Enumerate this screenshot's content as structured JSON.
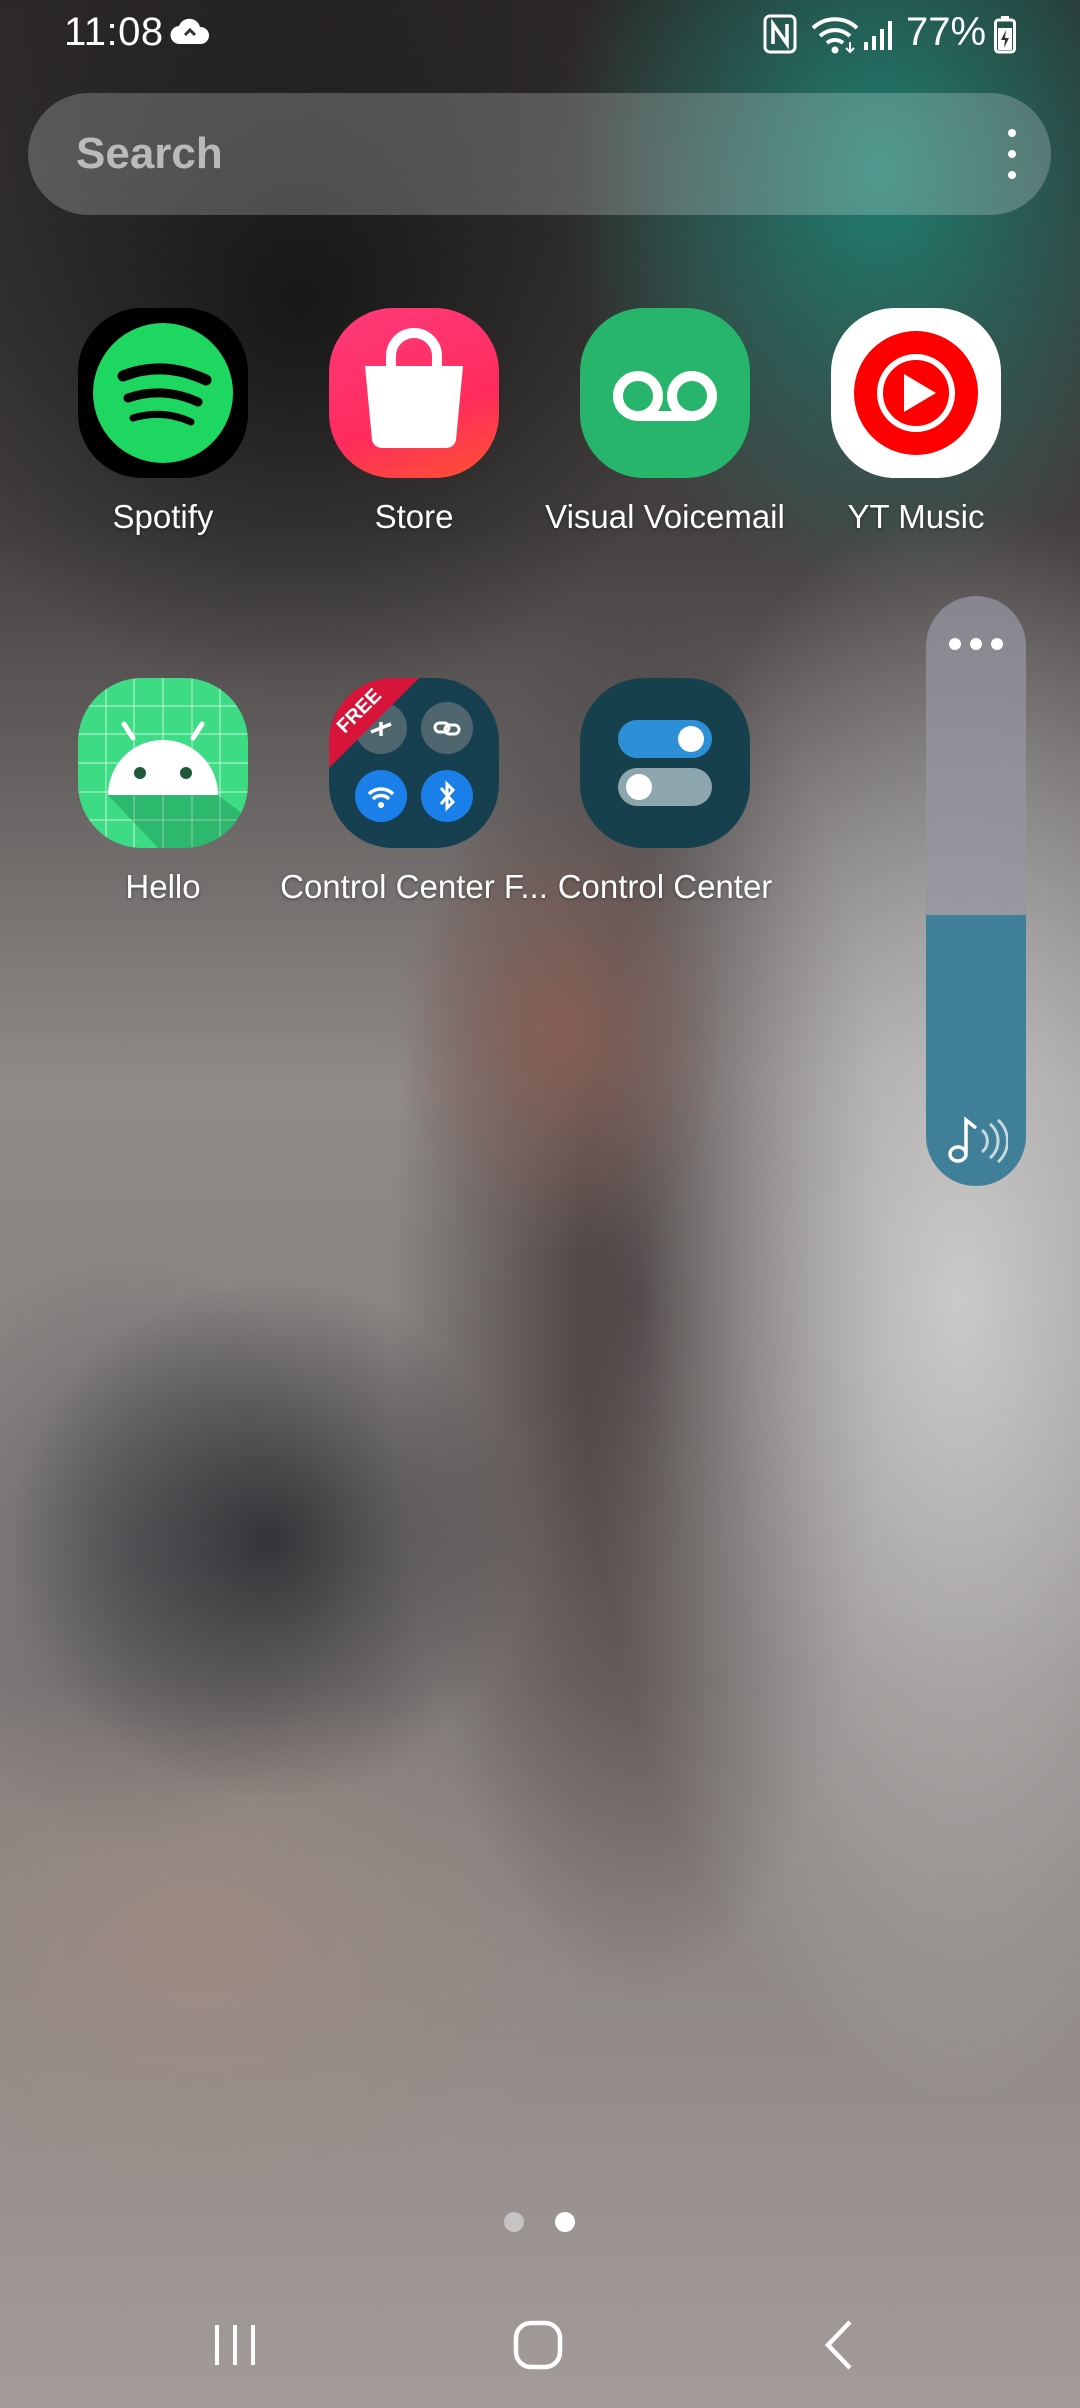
{
  "status_bar": {
    "time": "11:08",
    "battery_percent": "77%",
    "icons": [
      "cloud-sync-icon",
      "nfc-icon",
      "wifi-icon",
      "signal-icon",
      "battery-charging-icon"
    ]
  },
  "search": {
    "placeholder": "Search",
    "more_icon": "more-vertical-icon"
  },
  "apps": [
    {
      "label": "Spotify",
      "icon": "spotify-icon"
    },
    {
      "label": "Store",
      "icon": "store-bag-icon"
    },
    {
      "label": "Visual Voicemail",
      "icon": "voicemail-icon"
    },
    {
      "label": "YT Music",
      "icon": "yt-music-icon"
    },
    {
      "label": "Hello",
      "icon": "android-icon"
    },
    {
      "label": "Control Center F...",
      "icon": "control-center-free-icon",
      "badge": "FREE"
    },
    {
      "label": "Control Center",
      "icon": "toggle-switches-icon"
    }
  ],
  "volume_panel": {
    "level": 0.46,
    "more_icon": "more-horizontal-icon",
    "stream_icon": "music-note-icon",
    "colors": {
      "fill": "#3f7f97",
      "track": "#9596a0"
    }
  },
  "page_indicator": {
    "pages": 2,
    "current": 2
  },
  "nav_bar": {
    "buttons": [
      "recents-icon",
      "home-icon",
      "back-icon"
    ]
  }
}
